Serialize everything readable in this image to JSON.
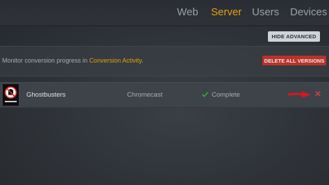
{
  "nav": {
    "items": [
      "Web",
      "Server",
      "Users",
      "Devices"
    ],
    "active": "Server"
  },
  "toolbar": {
    "hide_advanced_label": "HIDE ADVANCED"
  },
  "notice": {
    "prefix": "Monitor conversion progress in ",
    "link": "Conversion Activity",
    "suffix": "."
  },
  "actions": {
    "delete_all_label": "DELETE ALL VERSIONS"
  },
  "versions": [
    {
      "title": "Ghostbusters",
      "device": "Chromecast",
      "status": "Complete",
      "status_icon": "checkmark-icon",
      "remove_icon": "close-icon"
    }
  ],
  "colors": {
    "accent": "#e5a00d",
    "danger": "#b8332b",
    "success": "#2f9e44",
    "arrow": "#e0141b"
  }
}
